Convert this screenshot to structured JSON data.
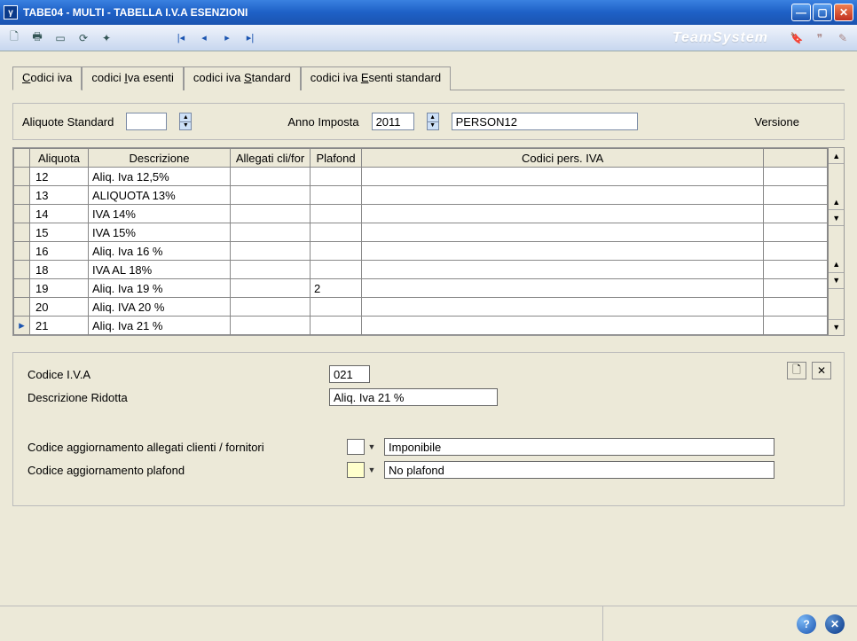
{
  "window": {
    "title": "TABE04  - MULTI -   TABELLA I.V.A ESENZIONI",
    "app_icon_glyph": "γ"
  },
  "brand": "TeamSystem",
  "tabs": [
    {
      "pre": "",
      "ul": "C",
      "post": "odici iva",
      "active": true
    },
    {
      "pre": "codici ",
      "ul": "I",
      "post": "va esenti",
      "active": false
    },
    {
      "pre": "codici iva ",
      "ul": "S",
      "post": "tandard",
      "active": false
    },
    {
      "pre": "codici iva ",
      "ul": "E",
      "post": "senti standard",
      "active": false
    }
  ],
  "filters": {
    "aliquote_label": "Aliquote Standard",
    "aliquote_value": "",
    "anno_label": "Anno Imposta",
    "anno_value": "2011",
    "person_value": "PERSON12",
    "versione_label": "Versione"
  },
  "grid": {
    "columns": [
      "Aliquota",
      "Descrizione",
      "Allegati cli/for",
      "Plafond",
      "Codici pers. IVA",
      ""
    ],
    "rows": [
      {
        "marker": "",
        "aliquota": "12",
        "descr": "Aliq. Iva 12,5%",
        "alleg": "",
        "plafond": "",
        "pers": "",
        "extra": ""
      },
      {
        "marker": "",
        "aliquota": "13",
        "descr": "ALIQUOTA 13%",
        "alleg": "",
        "plafond": "",
        "pers": "",
        "extra": ""
      },
      {
        "marker": "",
        "aliquota": "14",
        "descr": "IVA 14%",
        "alleg": "",
        "plafond": "",
        "pers": "",
        "extra": ""
      },
      {
        "marker": "",
        "aliquota": "15",
        "descr": "IVA 15%",
        "alleg": "",
        "plafond": "",
        "pers": "",
        "extra": ""
      },
      {
        "marker": "",
        "aliquota": "16",
        "descr": "Aliq. Iva 16 %",
        "alleg": "",
        "plafond": "",
        "pers": "",
        "extra": ""
      },
      {
        "marker": "",
        "aliquota": "18",
        "descr": "IVA AL 18%",
        "alleg": "",
        "plafond": "",
        "pers": "",
        "extra": ""
      },
      {
        "marker": "",
        "aliquota": "19",
        "descr": "Aliq. Iva 19 %",
        "alleg": "",
        "plafond": "2",
        "pers": "",
        "extra": ""
      },
      {
        "marker": "",
        "aliquota": "20",
        "descr": "Aliq. IVA 20 %",
        "alleg": "",
        "plafond": "",
        "pers": "",
        "extra": ""
      },
      {
        "marker": "▸",
        "aliquota": "21",
        "descr": "Aliq. Iva 21 %",
        "alleg": "",
        "plafond": "",
        "pers": "",
        "extra": ""
      }
    ]
  },
  "detail": {
    "codice_label": "Codice I.V.A",
    "codice_value": "021",
    "descr_label": "Descrizione Ridotta",
    "descr_value": "Aliq. Iva 21 %",
    "alleg_label": "Codice aggiornamento allegati clienti / fornitori",
    "alleg_value": "Imponibile",
    "plafond_label": "Codice aggiornamento plafond",
    "plafond_value": "No plafond"
  },
  "icons": {
    "new_doc": "🗋",
    "close_x": "✕"
  }
}
